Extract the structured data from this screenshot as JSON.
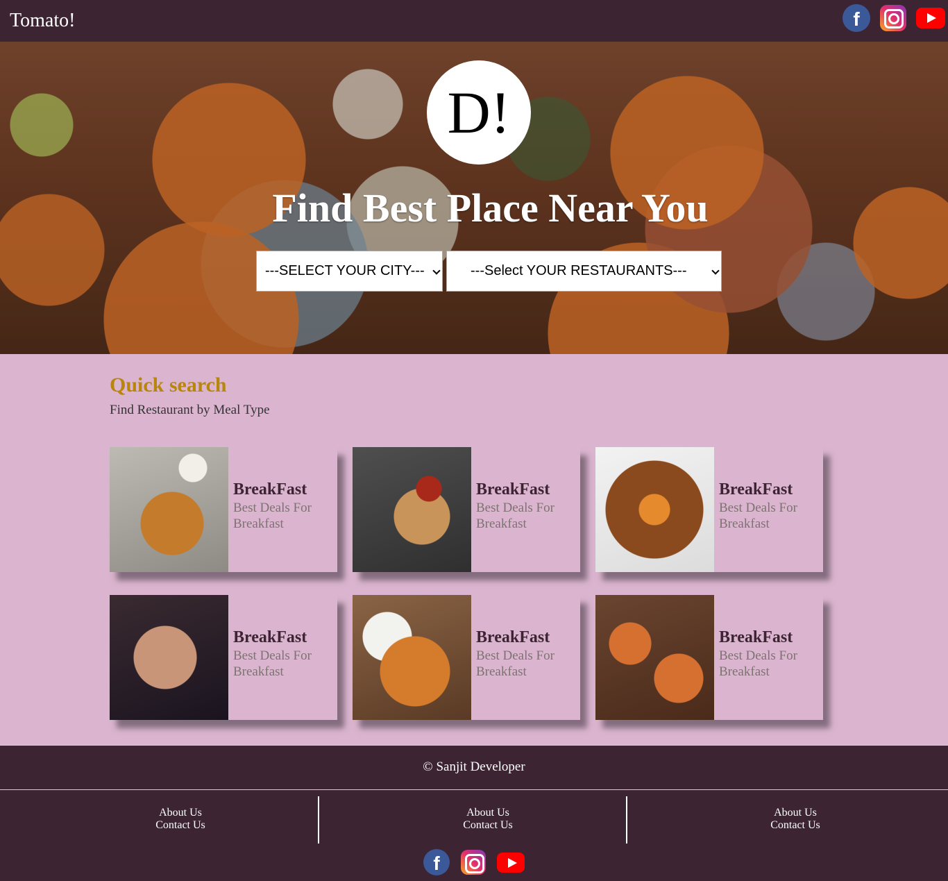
{
  "header": {
    "brand": "Tomato!",
    "social": [
      "facebook-icon",
      "instagram-icon",
      "youtube-icon"
    ]
  },
  "hero": {
    "logo": "D!",
    "title": "Find Best Place Near You",
    "city_select": "---SELECT YOUR CITY---",
    "restaurant_select": "---Select YOUR RESTAURANTS---"
  },
  "quick_search": {
    "title": "Quick search",
    "subtitle": "Find Restaurant by Meal Type",
    "cards": [
      {
        "title": "BreakFast",
        "desc": "Best Deals For Breakfast"
      },
      {
        "title": "BreakFast",
        "desc": "Best Deals For Breakfast"
      },
      {
        "title": "BreakFast",
        "desc": "Best Deals For Breakfast"
      },
      {
        "title": "BreakFast",
        "desc": "Best Deals For Breakfast"
      },
      {
        "title": "BreakFast",
        "desc": "Best Deals For Breakfast"
      },
      {
        "title": "BreakFast",
        "desc": "Best Deals For Breakfast"
      }
    ]
  },
  "footer": {
    "copyright": "© Sanjit Developer",
    "columns": [
      {
        "about": "About Us",
        "contact": "Contact Us"
      },
      {
        "about": "About Us",
        "contact": "Contact Us"
      },
      {
        "about": "About Us",
        "contact": "Contact Us"
      }
    ],
    "social": [
      "facebook-icon",
      "instagram-icon",
      "youtube-icon"
    ]
  },
  "colors": {
    "header_bg": "#3c2433",
    "page_bg": "#dbb5cf",
    "accent_gold": "#b8860b",
    "card_title": "#3c2433",
    "card_desc": "#7d7272"
  }
}
